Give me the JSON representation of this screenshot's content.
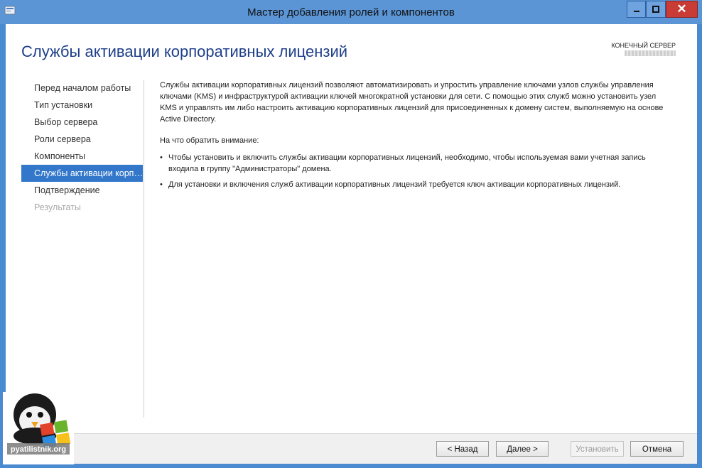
{
  "window": {
    "title": "Мастер добавления ролей и компонентов",
    "close_glyph": "✕"
  },
  "header": {
    "page_title": "Службы активации корпоративных лицензий",
    "destination_label": "КОНЕЧНЫЙ СЕРВЕР"
  },
  "nav": {
    "items": [
      {
        "label": "Перед началом работы",
        "state": "normal"
      },
      {
        "label": "Тип установки",
        "state": "normal"
      },
      {
        "label": "Выбор сервера",
        "state": "normal"
      },
      {
        "label": "Роли сервера",
        "state": "normal"
      },
      {
        "label": "Компоненты",
        "state": "normal"
      },
      {
        "label": "Службы активации корпоративных лицензий",
        "state": "active"
      },
      {
        "label": "Подтверждение",
        "state": "normal"
      },
      {
        "label": "Результаты",
        "state": "disabled"
      }
    ]
  },
  "content": {
    "intro": "Службы активации корпоративных лицензий позволяют автоматизировать и упростить управление ключами узлов службы управления ключами (KMS) и инфраструктурой активации ключей многократной установки для сети. С помощью этих служб можно установить узел KMS и управлять им либо настроить активацию корпоративных лицензий для присоединенных к домену систем, выполняемую на основе Active Directory.",
    "notes_heading": "На что обратить внимание:",
    "bullets": [
      "Чтобы установить и включить службы активации корпоративных лицензий, необходимо, чтобы используемая вами учетная запись входила в группу \"Администраторы\" домена.",
      "Для установки и включения служб активации корпоративных лицензий требуется ключ активации корпоративных лицензий."
    ]
  },
  "footer": {
    "prev_label": "< Назад",
    "next_label": "Далее >",
    "install_label": "Установить",
    "cancel_label": "Отмена"
  },
  "watermark": {
    "text": "pyatilistnik.org"
  },
  "colors": {
    "titlebar": "#5b95d6",
    "accent": "#3277c9",
    "page_title": "#1e3f8a",
    "close": "#c83c35"
  }
}
